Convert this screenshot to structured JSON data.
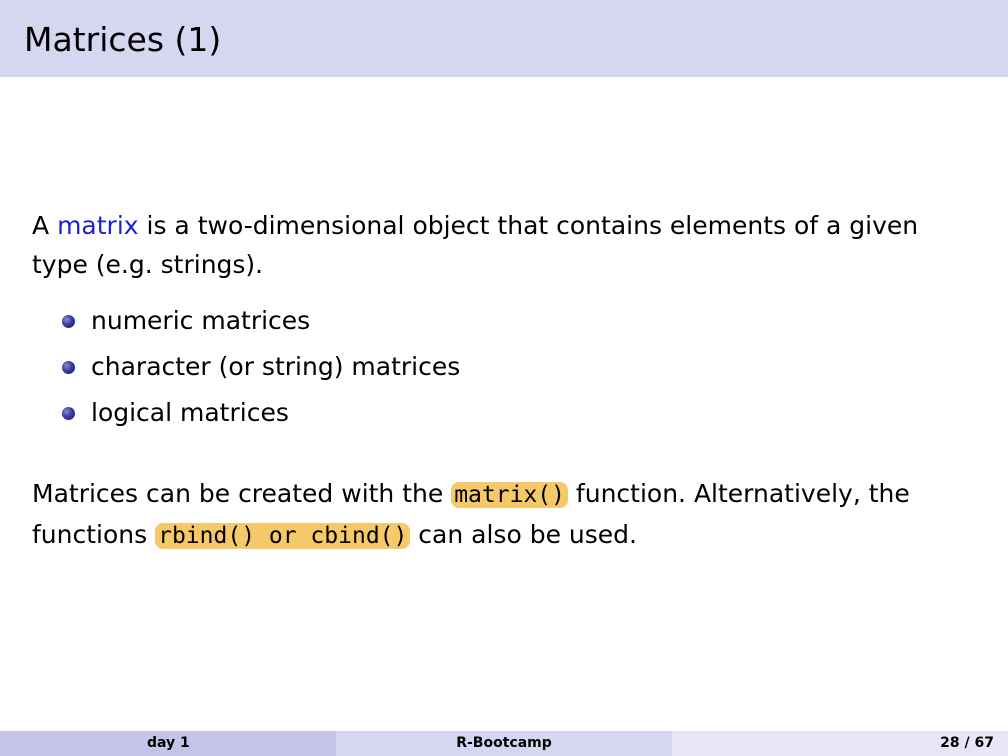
{
  "header": {
    "title": "Matrices (1)"
  },
  "content": {
    "intro_prefix": "A ",
    "intro_keyword": "matrix",
    "intro_suffix": " is a two-dimensional object that contains elements of a given type (e.g. strings).",
    "bullets": [
      "numeric matrices",
      "character (or string) matrices",
      "logical matrices"
    ],
    "para2_part1": "Matrices can be created with the ",
    "para2_code1": "matrix()",
    "para2_part2": " function.  Alternatively, the functions ",
    "para2_code2": "rbind() or cbind()",
    "para2_part3": " can also be used."
  },
  "footer": {
    "left": "day 1",
    "center": "R-Bootcamp",
    "right": "28 / 67"
  },
  "colors": {
    "title_bar": "#d6d6f0",
    "accent": "#1f1fd6",
    "code_highlight": "#f5c96a"
  }
}
